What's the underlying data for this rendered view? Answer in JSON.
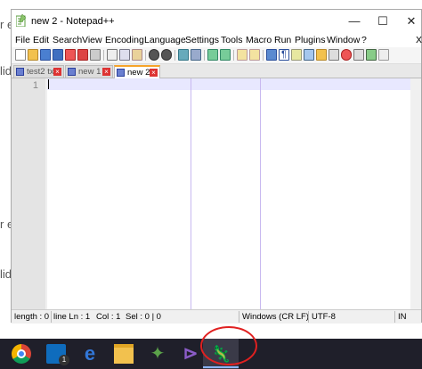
{
  "background_fragments": [
    "r e",
    "lid",
    "r e",
    "lid"
  ],
  "window": {
    "title": "new 2 - Notepad++",
    "minimize": "—",
    "maximize": "☐",
    "close": "✕",
    "menu_close": "X"
  },
  "menu": [
    "File",
    "Edit",
    "Search",
    "View",
    "Encoding",
    "Language",
    "Settings",
    "Tools",
    "Macro",
    "Run",
    "Plugins",
    "Window",
    "?"
  ],
  "tabs": [
    {
      "label": "test2 txt",
      "active": false
    },
    {
      "label": "new 1",
      "active": false
    },
    {
      "label": "new 2",
      "active": true
    }
  ],
  "editor": {
    "line_numbers": [
      "1"
    ]
  },
  "status": {
    "length": "length : 0",
    "lines": "line Ln : 1",
    "col": "Col : 1",
    "sel": "Sel : 0 | 0",
    "eol": "Windows (CR LF)",
    "encoding": "UTF-8",
    "mode": "IN"
  },
  "taskbar": {
    "items": [
      "chrome-icon",
      "mail-icon",
      "edge-icon",
      "file-explorer-icon",
      "sourcetree-icon",
      "visual-studio-icon",
      "notepad-plus-plus-icon"
    ],
    "mail_badge": "1"
  },
  "colors": {
    "accent_tab": "#f6a42b",
    "annotation_circle": "#e02020",
    "current_line": "#e8e8ff"
  }
}
